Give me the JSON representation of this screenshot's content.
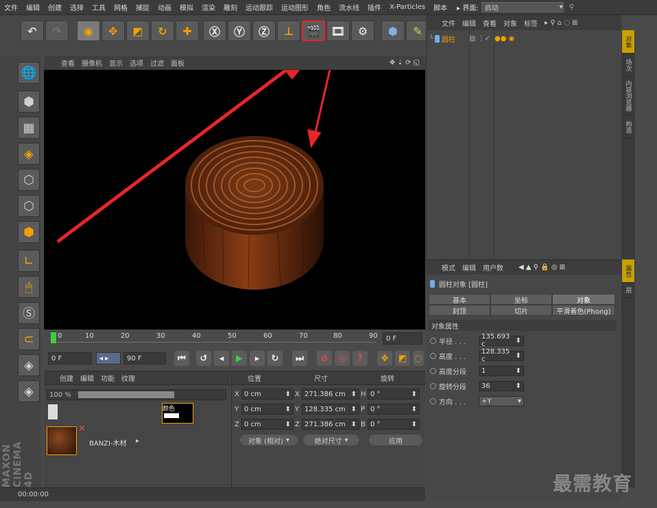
{
  "menu": [
    "文件",
    "编辑",
    "创建",
    "选择",
    "工具",
    "网格",
    "捕捉",
    "动画",
    "模拟",
    "渲染",
    "雕刻",
    "运动跟踪",
    "运动图形",
    "角色",
    "流水线",
    "插件",
    "X-Particles",
    "脚本"
  ],
  "layout": {
    "label": "▸ 界面:",
    "value": "启动"
  },
  "viewport": {
    "menu": [
      "查看",
      "摄像机",
      "显示",
      "选项",
      "过滤",
      "面板"
    ]
  },
  "timeline": {
    "ticks": [
      "0",
      "10",
      "20",
      "30",
      "40",
      "50",
      "60",
      "70",
      "80",
      "90"
    ],
    "end_field": "0 F"
  },
  "transport": {
    "start": "0 F",
    "end": "90 F"
  },
  "material_panel": {
    "menu": [
      "创建",
      "编辑",
      "功能",
      "纹理"
    ],
    "zoom": "100 %",
    "channel": "颜色",
    "material_name": "BANZI-木材"
  },
  "coord_panel": {
    "headers": [
      "位置",
      "尺寸",
      "旋转"
    ],
    "rows": [
      {
        "axis": "X",
        "pos": "0 cm",
        "size_axis": "X",
        "size": "271.386 cm",
        "rot_axis": "H",
        "rot": "0 °"
      },
      {
        "axis": "Y",
        "pos": "0 cm",
        "size_axis": "Y",
        "size": "128.335 cm",
        "rot_axis": "P",
        "rot": "0 °"
      },
      {
        "axis": "Z",
        "pos": "0 cm",
        "size_axis": "Z",
        "size": "271.386 cm",
        "rot_axis": "B",
        "rot": "0 °"
      }
    ],
    "mode": "对象 (相对)",
    "size_mode": "绝对尺寸",
    "apply": "应用"
  },
  "status": "00:00:00",
  "object_manager": {
    "menu": [
      "文件",
      "编辑",
      "查看",
      "对象",
      "标签"
    ],
    "object_name": "圆柱"
  },
  "attributes": {
    "menu": [
      "模式",
      "编辑",
      "用户数"
    ],
    "title": "圆柱对象 [圆柱]",
    "tabs": [
      "基本",
      "坐标",
      "对象",
      "封顶",
      "切片",
      "平滑着色(Phong)"
    ],
    "section": "对象属性",
    "props": [
      {
        "label": "半径 . . .",
        "value": "135.693 c"
      },
      {
        "label": "高度 . . .",
        "value": "128.335 c"
      },
      {
        "label": "高度分段",
        "value": "1"
      },
      {
        "label": "旋转分段",
        "value": "36"
      },
      {
        "label": "方向 . . .",
        "value": "+Y"
      }
    ]
  },
  "right_tabs": [
    "对象",
    "场次",
    "内容浏览器",
    "构造"
  ],
  "right_tabs2": [
    "属性",
    "层"
  ],
  "watermark": "最需教育",
  "maxon": "MAXON CINEMA 4D",
  "colors": {
    "accent": "#f2a100",
    "arrow": "#e8262a",
    "selected": "#4f6d9a"
  }
}
